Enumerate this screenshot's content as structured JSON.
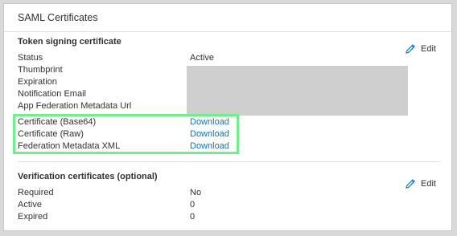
{
  "card": {
    "title": "SAML Certificates",
    "highlight_color": "#6ef08b"
  },
  "token_signing": {
    "heading": "Token signing certificate",
    "edit_label": "Edit",
    "edit_icon": "pencil-icon",
    "rows": [
      {
        "label": "Status",
        "value": "Active"
      },
      {
        "label": "Thumbprint",
        "value": ""
      },
      {
        "label": "Expiration",
        "value": ""
      },
      {
        "label": "Notification Email",
        "value": ""
      },
      {
        "label": "App Federation Metadata Url",
        "value": ""
      }
    ],
    "downloads": [
      {
        "label": "Certificate (Base64)",
        "link": "Download"
      },
      {
        "label": "Certificate (Raw)",
        "link": "Download"
      },
      {
        "label": "Federation Metadata XML",
        "link": "Download"
      }
    ]
  },
  "verification": {
    "heading": "Verification certificates (optional)",
    "edit_label": "Edit",
    "edit_icon": "pencil-icon",
    "rows": [
      {
        "label": "Required",
        "value": "No"
      },
      {
        "label": "Active",
        "value": "0"
      },
      {
        "label": "Expired",
        "value": "0"
      }
    ]
  },
  "colors": {
    "link": "#0078d4",
    "redaction": "#cfcfcf"
  }
}
